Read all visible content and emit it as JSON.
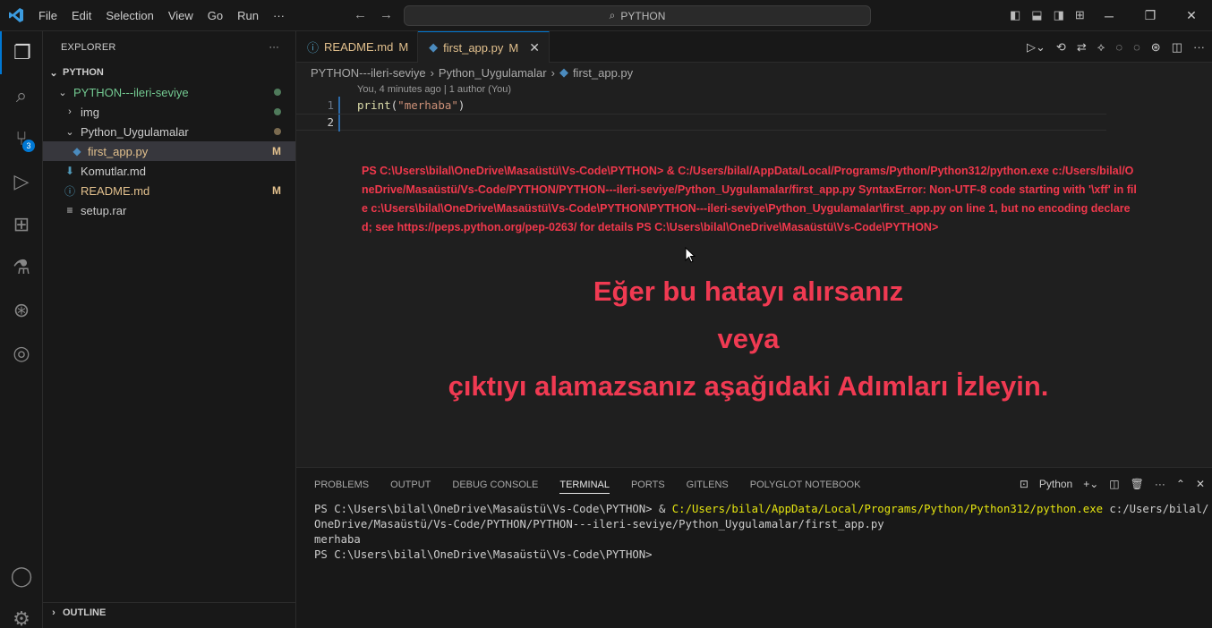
{
  "titlebar": {
    "menu": [
      "File",
      "Edit",
      "Selection",
      "View",
      "Go",
      "Run",
      "···"
    ],
    "search": "PYTHON"
  },
  "activity": {
    "scm_badge": "3"
  },
  "sidebar": {
    "title": "EXPLORER",
    "more": "···",
    "workspace": "PYTHON",
    "items": [
      {
        "label": "PYTHON---ileri-seviye",
        "twisty": "⌄",
        "icon": "",
        "color": "#73c991",
        "decoration": "dot"
      },
      {
        "label": "img",
        "twisty": "›",
        "icon": "",
        "color": "#cccccc",
        "decoration": "dot"
      },
      {
        "label": "Python_Uygulamalar",
        "twisty": "⌄",
        "icon": "",
        "color": "#cccccc",
        "decoration": "dot-mod"
      },
      {
        "label": "first_app.py",
        "twisty": "",
        "icon": "py",
        "color": "#e2c08d",
        "decoration": "M"
      },
      {
        "label": "Komutlar.md",
        "twisty": "",
        "icon": "md-down",
        "color": "#cccccc",
        "decoration": ""
      },
      {
        "label": "README.md",
        "twisty": "",
        "icon": "info",
        "color": "#e2c08d",
        "decoration": "M"
      },
      {
        "label": "setup.rar",
        "twisty": "",
        "icon": "lines",
        "color": "#cccccc",
        "decoration": ""
      }
    ],
    "outline": "OUTLINE"
  },
  "tabs": [
    {
      "label": "README.md",
      "mod": "M"
    },
    {
      "label": "first_app.py",
      "mod": "M",
      "close": "✕"
    }
  ],
  "breadcrumb": [
    "PYTHON---ileri-seviye",
    "Python_Uygulamalar",
    "first_app.py"
  ],
  "editor": {
    "codelens": "You, 4 minutes ago | 1 author (You)",
    "line1_no": "1",
    "line2_no": "2",
    "code_fn": "print",
    "code_open": "(",
    "code_str": "\"merhaba\"",
    "code_close": ")",
    "error_text": "PS C:\\Users\\bilal\\OneDrive\\Masaüstü\\Vs-Code\\PYTHON> & C:/Users/bilal/AppData/Local/Programs/Python/Python312/python.exe c:/Users/bilal/OneDrive/Masaüstü/Vs-Code/PYTHON/PYTHON---ileri-seviye/Python_Uygulamalar/first_app.py SyntaxError: Non-UTF-8 code starting with '\\xff' in file c:\\Users\\bilal\\OneDrive\\Masaüstü\\Vs-Code\\PYTHON\\PYTHON---ileri-seviye\\Python_Uygulamalar\\first_app.py on line 1, but no encoding declared; see https://peps.python.org/pep-0263/ for details PS C:\\Users\\bilal\\OneDrive\\Masaüstü\\Vs-Code\\PYTHON>",
    "headline1": "Eğer bu hatayı alırsanız",
    "headline2": "veya",
    "headline3": "çıktıyı alamazsanız aşağıdaki Adımları İzleyin."
  },
  "panel": {
    "tabs": [
      "PROBLEMS",
      "OUTPUT",
      "DEBUG CONSOLE",
      "TERMINAL",
      "PORTS",
      "GITLENS",
      "POLYGLOT NOTEBOOK"
    ],
    "active_tab": "TERMINAL",
    "shell": "Python",
    "term_prompt1": "PS C:\\Users\\bilal\\OneDrive\\Masaüstü\\Vs-Code\\PYTHON> & ",
    "term_exe": "C:/Users/bilal/AppData/Local/Programs/Python/Python312/python.exe",
    "term_arg": " c:/Users/bilal/OneDrive/Masaüstü/Vs-Code/PYTHON/PYTHON---ileri-seviye/Python_Uygulamalar/first_app.py",
    "term_out": "merhaba",
    "term_prompt2": "PS C:\\Users\\bilal\\OneDrive\\Masaüstü\\Vs-Code\\PYTHON>"
  }
}
